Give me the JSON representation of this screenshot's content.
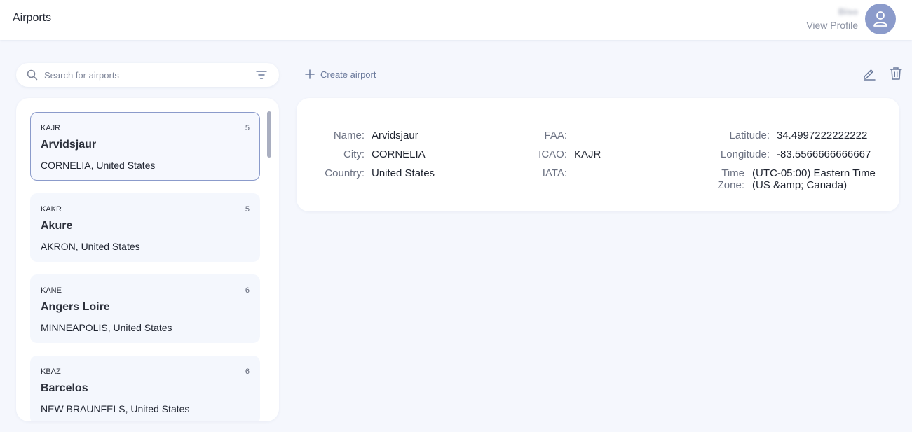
{
  "header": {
    "title": "Airports",
    "profile_name": "Biso",
    "profile_link": "View Profile"
  },
  "search": {
    "placeholder": "Search for airports",
    "value": ""
  },
  "toolbar": {
    "create_label": "Create airport"
  },
  "airports": [
    {
      "code": "KAJR",
      "count": "5",
      "name": "Arvidsjaur",
      "location": "CORNELIA, United States",
      "selected": true
    },
    {
      "code": "KAKR",
      "count": "5",
      "name": "Akure",
      "location": "AKRON, United States",
      "selected": false
    },
    {
      "code": "KANE",
      "count": "6",
      "name": "Angers Loire",
      "location": "MINNEAPOLIS, United States",
      "selected": false
    },
    {
      "code": "KBAZ",
      "count": "6",
      "name": "Barcelos",
      "location": "NEW BRAUNFELS, United States",
      "selected": false
    }
  ],
  "detail": {
    "name_label": "Name:",
    "name_value": "Arvidsjaur",
    "city_label": "City:",
    "city_value": "CORNELIA",
    "country_label": "Country:",
    "country_value": "United States",
    "faa_label": "FAA:",
    "faa_value": "",
    "icao_label": "ICAO:",
    "icao_value": "KAJR",
    "iata_label": "IATA:",
    "iata_value": "",
    "latitude_label": "Latitude:",
    "latitude_value": "34.4997222222222",
    "longitude_label": "Longitude:",
    "longitude_value": "-83.5566666666667",
    "timezone_label_1": "Time",
    "timezone_label_2": "Zone:",
    "timezone_value_1": "(UTC-05:00) Eastern Time",
    "timezone_value_2": "(US &amp; Canada)"
  },
  "colors": {
    "accent": "#8b9bcb",
    "background": "#f5f7fd",
    "card": "#f4f7fd"
  }
}
